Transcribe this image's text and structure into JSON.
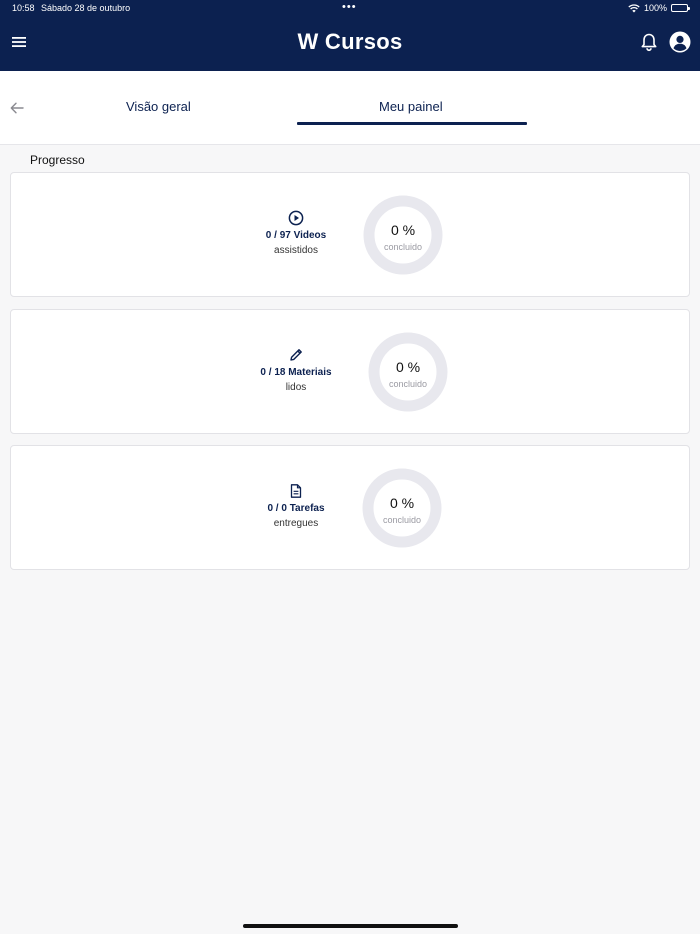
{
  "status_bar": {
    "time": "10:58",
    "date": "Sábado 28 de outubro",
    "dots": "•••",
    "battery": "100%"
  },
  "header": {
    "title": "W Cursos",
    "background": "#0c2150",
    "icons": [
      "menu-icon",
      "bell-icon",
      "user-avatar-icon"
    ]
  },
  "tabs": {
    "items": [
      {
        "label": "Visão geral",
        "active": false
      },
      {
        "label": "Meu painel",
        "active": true
      }
    ]
  },
  "progress": {
    "title": "Progresso",
    "cards": [
      {
        "icon": "play-circle-icon",
        "count": "0 / 97 Videos",
        "label": "assistidos",
        "percent_text": "0 %",
        "percent_label": "concluido",
        "percent": 0
      },
      {
        "icon": "pencil-icon",
        "count": "0 / 18 Materiais",
        "label": "lidos",
        "percent_text": "0 %",
        "percent_label": "concluido",
        "percent": 0
      },
      {
        "icon": "document-icon",
        "count": "0 / 0 Tarefas",
        "label": "entregues",
        "percent_text": "0 %",
        "percent_label": "concluido",
        "percent": 0
      }
    ]
  }
}
